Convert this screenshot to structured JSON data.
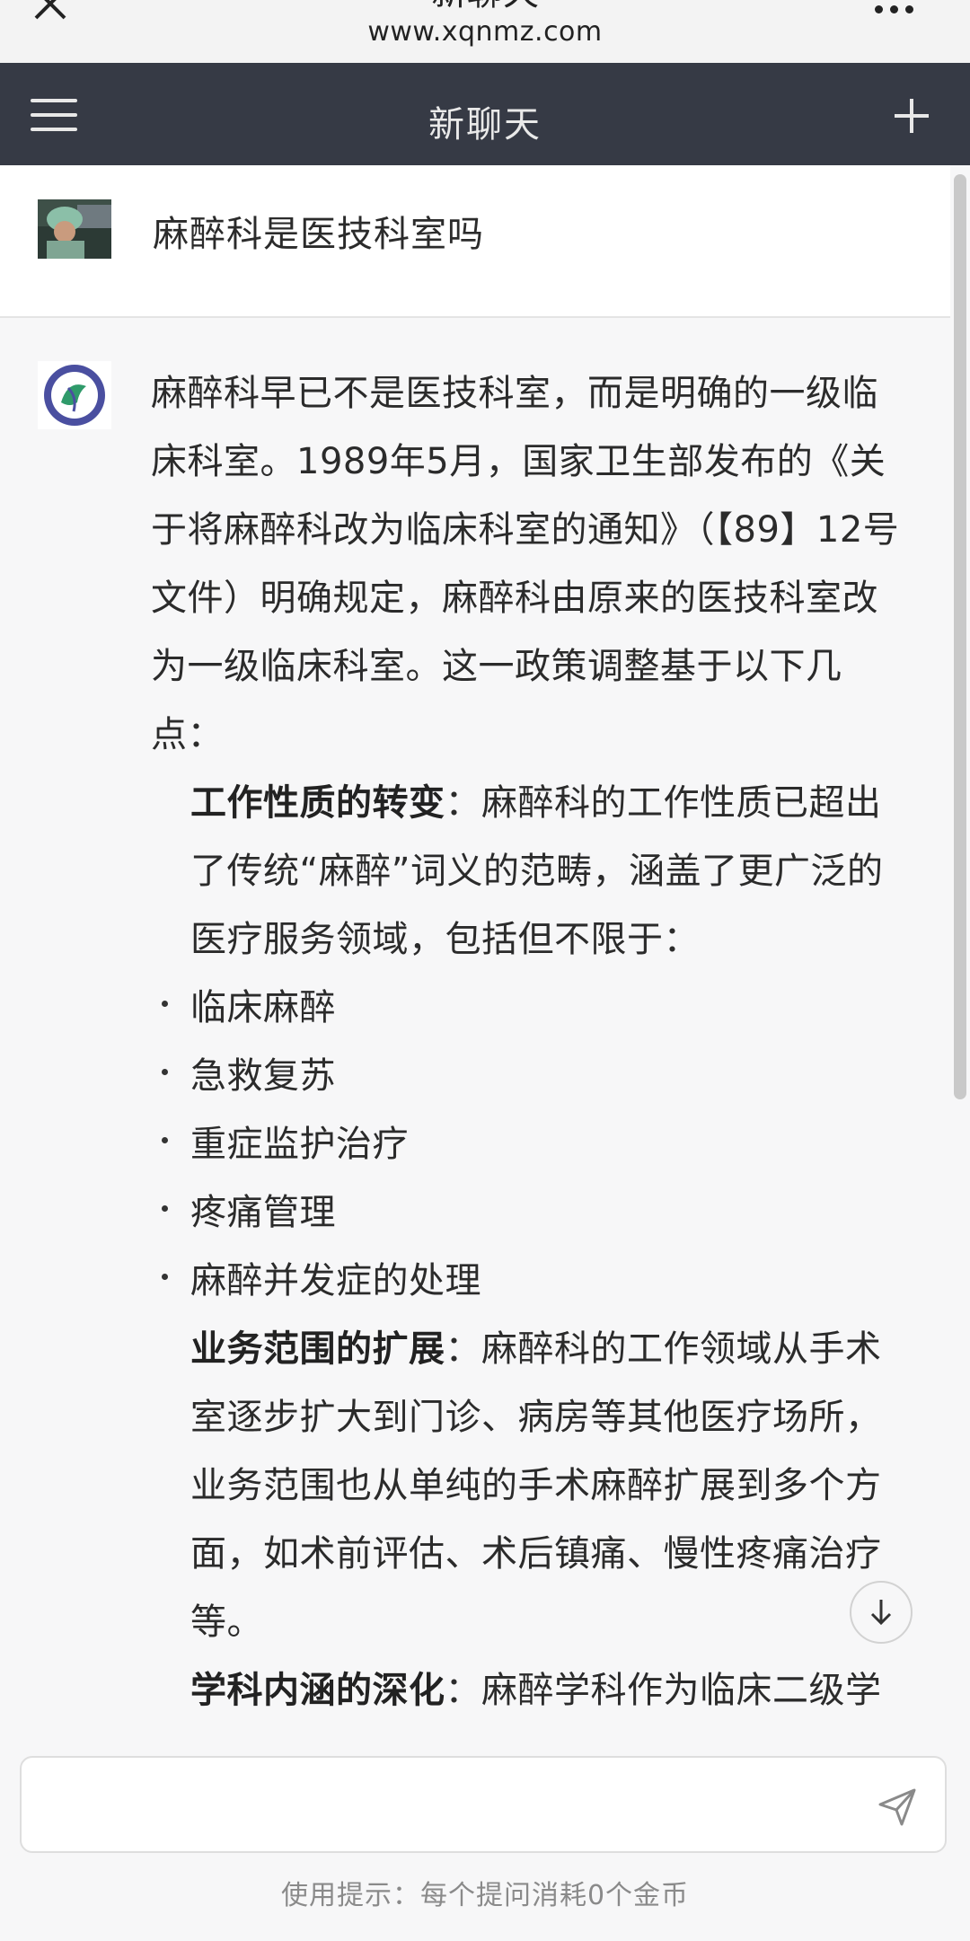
{
  "browser": {
    "title": "新聊天",
    "url": "www.xqnmz.com"
  },
  "header": {
    "title": "新聊天"
  },
  "user_message": {
    "text": "麻醉科是医技科室吗"
  },
  "ai_message": {
    "intro": "麻醉科早已不是医技科室，而是明确的一级临床科室。1989年5月，国家卫生部发布的《关于将麻醉科改为临床科室的通知》（【89】12号文件）明确规定，麻醉科由原来的医技科室改为一级临床科室。这一政策调整基于以下几点：",
    "point1_title": "工作性质的转变",
    "point1_text": "：麻醉科的工作性质已超出了传统“麻醉”词义的范畴，涵盖了更广泛的医疗服务领域，包括但不限于：",
    "bullets": [
      "临床麻醉",
      "急救复苏",
      "重症监护治疗",
      "疼痛管理",
      "麻醉并发症的处理"
    ],
    "point2_title": "业务范围的扩展",
    "point2_text": "：麻醉科的工作领域从手术室逐步扩大到门诊、病房等其他医疗场所，业务范围也从单纯的手术麻醉扩展到多个方面，如术前评估、术后镇痛、慢性疼痛治疗等。",
    "point3_title": "学科内涵的深化",
    "point3_text": "：麻醉学科作为临床二级学科，其一级学科的内涵在不断深化"
  },
  "input": {
    "placeholder": ""
  },
  "footer": {
    "tip": "使用提示：每个提问消耗0个金币"
  },
  "icons": {
    "close": "close-icon",
    "more": "more-dots-icon",
    "menu": "hamburger-menu-icon",
    "new_chat": "plus-icon",
    "scroll_down": "arrow-down-icon",
    "send": "send-icon"
  },
  "colors": {
    "header_bg": "#363a45",
    "page_bg": "#f7f7f8"
  }
}
